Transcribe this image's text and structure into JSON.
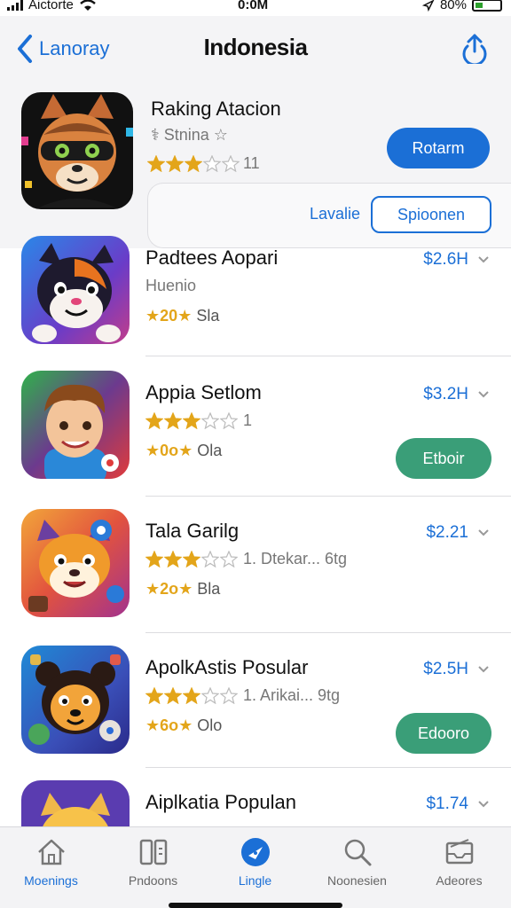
{
  "status_bar": {
    "carrier": "Aictorte",
    "time": "0:0M",
    "battery": "80%"
  },
  "nav": {
    "back_label": "Lanoray",
    "title": "Indonesia"
  },
  "featured": {
    "name": "Raking Atacion",
    "subtitle": "Stnina",
    "rating": 3,
    "rating_count": "11",
    "primary_button": "Rotarm",
    "link_label": "Lavalie",
    "secondary_button": "Spioonen"
  },
  "apps": [
    {
      "name": "Padtees Aopari",
      "line2_text": "Huenio",
      "stars": null,
      "line3_badge": "★20★",
      "line3_text": "Sla",
      "price": "$2.6H",
      "button": null
    },
    {
      "name": "Appia Setlom",
      "line2_text": "1",
      "stars": 3,
      "line3_badge": "★0o★",
      "line3_text": "Ola",
      "price": "$3.2H",
      "button": "Etboir"
    },
    {
      "name": "Tala Garilg",
      "line2_text": "1. Dtekar... 6tg",
      "stars": 3,
      "line3_badge": "★2o★",
      "line3_text": "Bla",
      "price": "$2.21",
      "button": null
    },
    {
      "name": "ApolkAstis Posular",
      "line2_text": "1. Arikai... 9tg",
      "stars": 3,
      "line3_badge": "★6o★",
      "line3_text": "Olo",
      "price": "$2.5H",
      "button": "Edooro"
    },
    {
      "name": "Aiplkatia Populan",
      "line2_text": "",
      "stars": null,
      "line3_badge": "",
      "line3_text": "",
      "price": "$1.74",
      "button": null
    }
  ],
  "tabs": [
    {
      "label": "Moenings"
    },
    {
      "label": "Pndoons"
    },
    {
      "label": "Lingle"
    },
    {
      "label": "Noonesien"
    },
    {
      "label": "Adeores"
    }
  ],
  "colors": {
    "accent": "#1b6fd6",
    "green": "#3a9e78",
    "star": "#e3a51a"
  }
}
